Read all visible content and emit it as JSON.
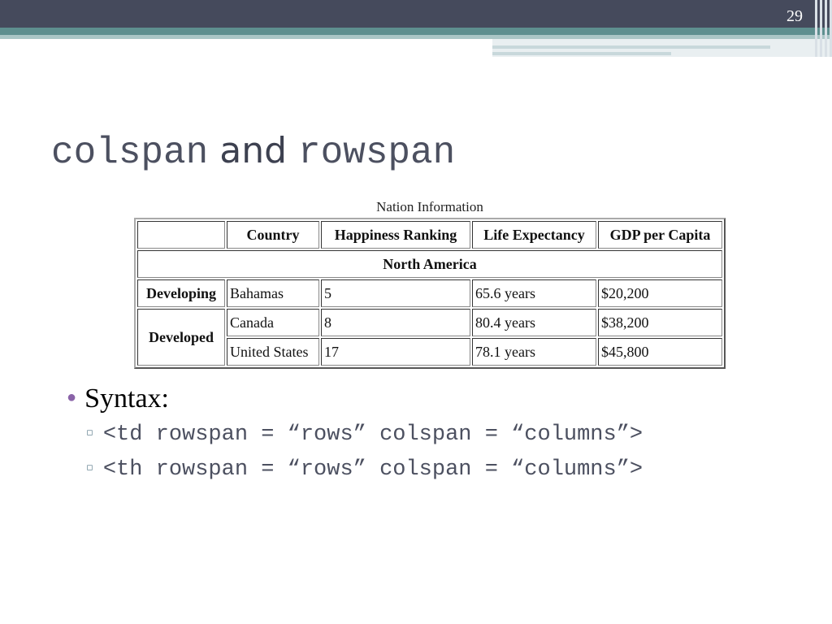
{
  "slide": {
    "page_number": "29",
    "title": {
      "part1": "colspan",
      "part2": "and",
      "part3": "rowspan"
    }
  },
  "table": {
    "caption": "Nation Information",
    "headers": [
      "",
      "Country",
      "Happiness Ranking",
      "Life Expectancy",
      "GDP per Capita"
    ],
    "region": "North America",
    "groups": {
      "developing": "Developing",
      "developed": "Developed"
    },
    "rows": [
      {
        "country": "Bahamas",
        "happiness": "5",
        "life": "65.6 years",
        "gdp": "$20,200"
      },
      {
        "country": "Canada",
        "happiness": "8",
        "life": "80.4 years",
        "gdp": "$38,200"
      },
      {
        "country": "United States",
        "happiness": "17",
        "life": "78.1 years",
        "gdp": "$45,800"
      }
    ]
  },
  "bullets": {
    "main": "Syntax:",
    "sub": [
      "<td rowspan = “rows” colspan = “columns”>",
      "<th rowspan = “rows” colspan = “columns”>"
    ]
  },
  "colors": {
    "header_dark": "#454a5c",
    "header_teal": "#5e8f8f",
    "bullet_accent": "#8a63a8"
  }
}
